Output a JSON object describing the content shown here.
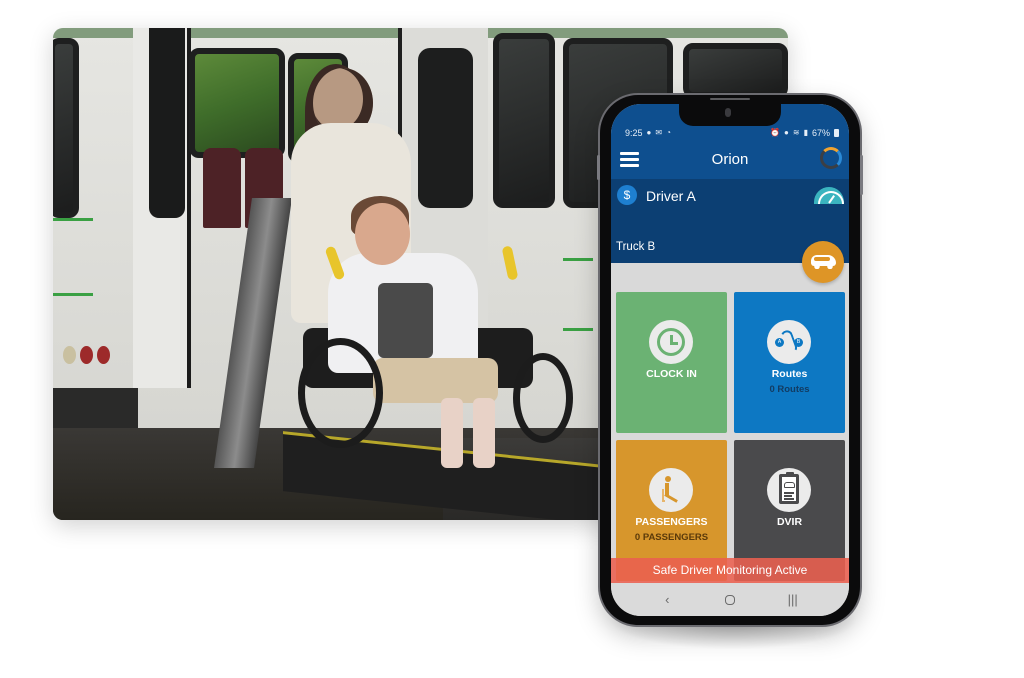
{
  "photo": {
    "description": "Woman pushing a smiling woman in a wheelchair onto a bus wheelchair lift",
    "colors": {
      "bus": "#e6e6e2",
      "stripe": "#3aa043",
      "seat": "#4d2226",
      "handle": "#e8c52b"
    }
  },
  "phone": {
    "status_bar": {
      "time": "9:25",
      "left_icons": [
        "chat-icon",
        "mail-icon",
        "app-icon"
      ],
      "right_icons": [
        "alarm-icon",
        "location-icon",
        "wifi-icon",
        "signal-icon"
      ],
      "battery": "67%"
    },
    "app_bar": {
      "title": "Orion",
      "menu_icon": "hamburger-icon",
      "sync_icon": "sync-status-icon"
    },
    "driver_panel": {
      "driver_name": "Driver A",
      "driver_icon": "dollar-icon",
      "gauge_icon": "speedometer-icon",
      "vehicle_name": "Truck B",
      "vehicle_icon": "van-icon"
    },
    "tiles": [
      {
        "label": "CLOCK IN",
        "sub": "",
        "icon": "clock-icon",
        "color": "#6bb273"
      },
      {
        "label": "Routes",
        "sub": "0 Routes",
        "icon": "route-icon",
        "color": "#0d78c3"
      },
      {
        "label": "PASSENGERS",
        "sub": "0 PASSENGERS",
        "icon": "passenger-seat-icon",
        "color": "#d7962c"
      },
      {
        "label": "DVIR",
        "sub": "",
        "icon": "clipboard-inspection-icon",
        "color": "#4a4a4c"
      }
    ],
    "banner": {
      "text": "Safe Driver Monitoring Active",
      "color": "#eb6050"
    },
    "nav_bar": {
      "back": "‹",
      "home": "home",
      "recents": "|||"
    },
    "colors": {
      "app_bar": "#0e4f8f",
      "driver_panel": "#0c3f73",
      "accent_orange": "#de9526"
    }
  }
}
